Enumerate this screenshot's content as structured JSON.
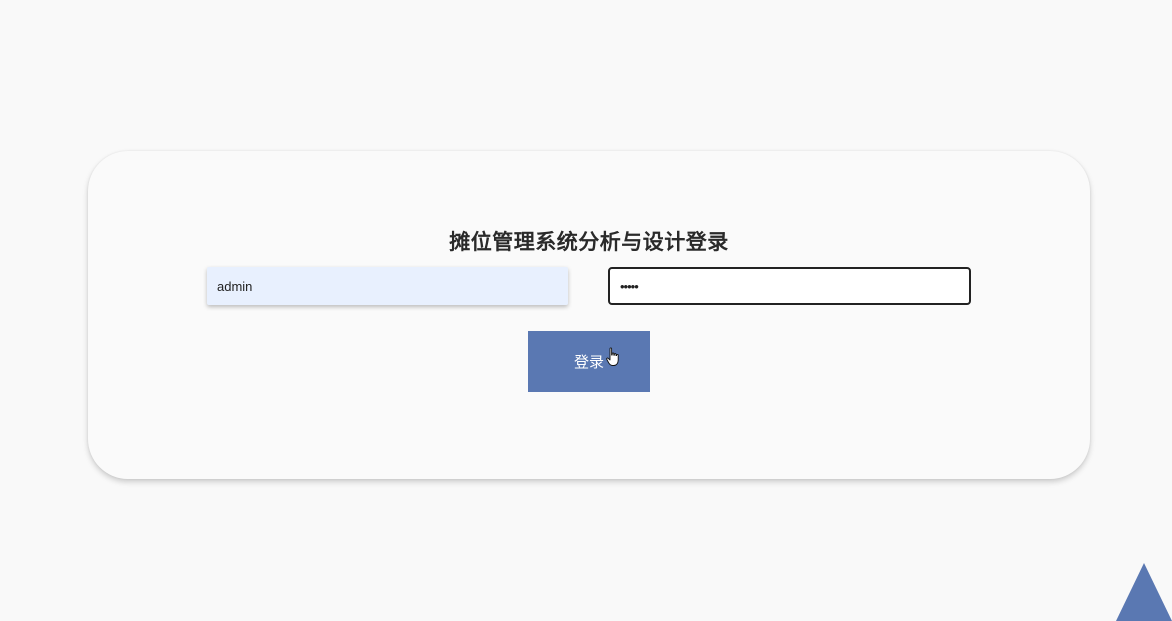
{
  "login": {
    "title": "摊位管理系统分析与设计登录",
    "username_value": "admin",
    "password_value": "•••••",
    "button_label": "登录"
  },
  "colors": {
    "accent": "#5a78b2",
    "autofill_bg": "#e8f0fe",
    "card_bg": "#fafafa",
    "page_bg": "#f9f9f9"
  },
  "icons": {
    "cursor": "hand-pointer-icon",
    "corner": "triangle-icon"
  }
}
